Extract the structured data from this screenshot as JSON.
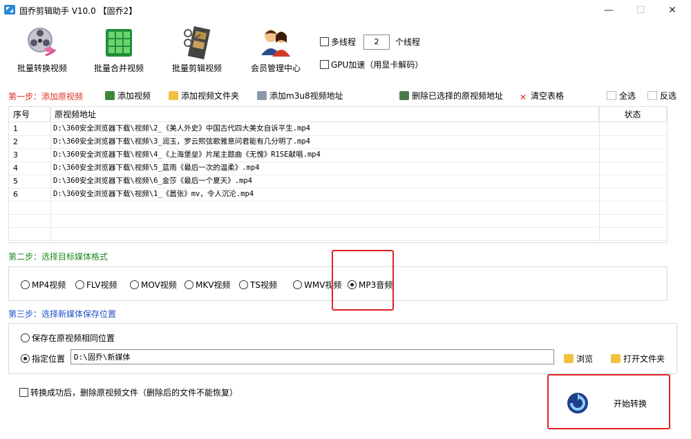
{
  "window": {
    "title": "固乔剪辑助手 V10.0 【固乔2】",
    "minimize": "—",
    "maximize": "☐",
    "close": "✕"
  },
  "toolbar": {
    "items": [
      {
        "label": "批量转换视频",
        "icon": "film-reel-icon"
      },
      {
        "label": "批量合并视频",
        "icon": "merge-grid-icon"
      },
      {
        "label": "批量剪辑视频",
        "icon": "scissors-film-icon"
      },
      {
        "label": "会员管理中心",
        "icon": "members-icon"
      }
    ],
    "multithread_label": "多线程",
    "thread_count": "2",
    "thread_unit": "个线程",
    "gpu_label": "GPU加速（用显卡解码）"
  },
  "step1": {
    "title": "第一步：添加原视频",
    "add_video": "添加视频",
    "add_folder": "添加视频文件夹",
    "add_m3u8": "添加m3u8视频地址",
    "delete_selected": "删除已选择的原视频地址",
    "clear_table": "清空表格",
    "select_all": "全选",
    "invert": "反选"
  },
  "table": {
    "headers": {
      "index": "序号",
      "path": "原视频地址",
      "status": "状态"
    },
    "rows": [
      {
        "index": "1",
        "path": "D:\\360安全浏览器下载\\视频\\2_《美人外史》中国古代四大美女自诉平生.mp4"
      },
      {
        "index": "2",
        "path": "D:\\360安全浏览器下载\\视频\\3_润玉，罗云熙弦歌雅意问君能有几分明了.mp4"
      },
      {
        "index": "3",
        "path": "D:\\360安全浏览器下载\\视频\\4_《上海堡垒》片尾主题曲《无愧》R1SE献唱.mp4"
      },
      {
        "index": "4",
        "path": "D:\\360安全浏览器下载\\视频\\5_蓝雨《最后一次的温柔》.mp4"
      },
      {
        "index": "5",
        "path": "D:\\360安全浏览器下载\\视频\\6_金莎《最后一个夏天》.mp4"
      },
      {
        "index": "6",
        "path": "D:\\360安全浏览器下载\\视频\\1_《嚣张》mv，令人沉沦.mp4"
      }
    ]
  },
  "step2": {
    "title": "第二步：选择目标媒体格式",
    "formats": [
      "MP4视频",
      "FLV视频",
      "MOV视频",
      "MKV视频",
      "TS视频",
      "WMV视频",
      "MP3音频"
    ],
    "selected": "MP3音频"
  },
  "step3": {
    "title": "第三步：选择新媒体保存位置",
    "same_location": "保存在原视频相同位置",
    "specify": "指定位置",
    "path": "D:\\固乔\\新媒体",
    "browse": "浏览",
    "open_folder": "打开文件夹"
  },
  "footer": {
    "delete_after": "转换成功后，删除原视频文件（删除后的文件不能恢复）",
    "start": "开始转换"
  }
}
